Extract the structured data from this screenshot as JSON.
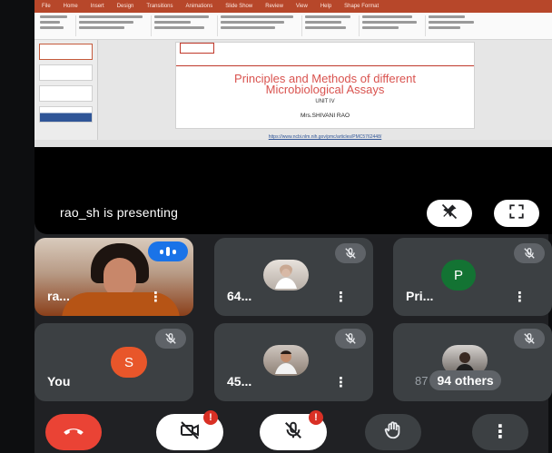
{
  "powerpoint": {
    "titlebar_items": [
      "File",
      "Home",
      "Insert",
      "Design",
      "Transitions",
      "Animations",
      "Slide Show",
      "Review",
      "View",
      "Help",
      "Shape Format"
    ],
    "slide": {
      "title": "Principles and Methods of different Microbiological Assays",
      "unit": "UNIT IV",
      "author": "Mrs.SHIVANI RAO",
      "link": "https://www.ncbi.nlm.nih.gov/pmc/articles/PMC5762448/"
    }
  },
  "presentation": {
    "presenter_text": "rao_sh is presenting"
  },
  "participants": [
    {
      "name": "ra...",
      "kind": "video",
      "speaking": true
    },
    {
      "name": "64...",
      "kind": "photo",
      "muted": true
    },
    {
      "name": "Pri...",
      "kind": "initial",
      "initial": "P",
      "color": "#137333",
      "muted": true
    },
    {
      "name": "You",
      "kind": "initial",
      "initial": "S",
      "color": "#e8562a",
      "muted": true
    },
    {
      "name": "45...",
      "kind": "photo",
      "muted": true
    },
    {
      "name": "94 others",
      "prefix": "87",
      "kind": "others",
      "muted": true
    }
  ],
  "controls": {
    "camera_badge": "!",
    "mic_badge": "!"
  },
  "colors": {
    "background": "#202124",
    "tile": "#3c4043",
    "end_call": "#ea4335",
    "speaking": "#1a73e8",
    "slide_title": "#d9534f"
  },
  "icons": [
    "unpin-icon",
    "fullscreen-icon",
    "mic-off-icon",
    "phone-end-icon",
    "camera-off-icon",
    "raise-hand-icon",
    "more-options-icon"
  ]
}
